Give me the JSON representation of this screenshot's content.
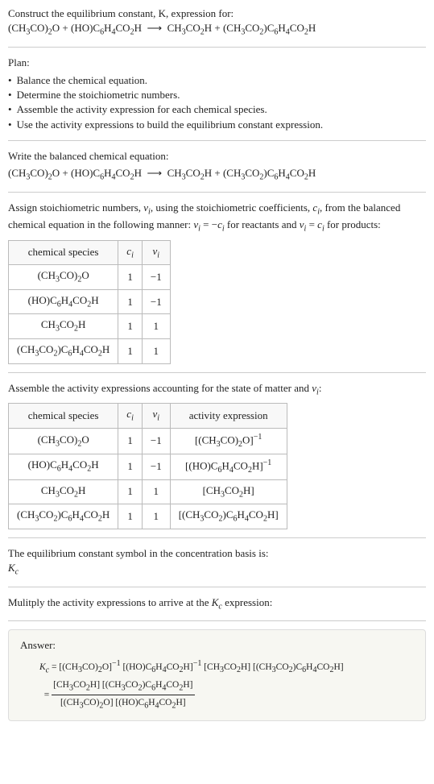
{
  "header": {
    "line1": "Construct the equilibrium constant, K, expression for:",
    "equation": "(CH₃CO)₂O + (HO)C₆H₄CO₂H ⟶ CH₃CO₂H + (CH₃CO₂)C₆H₄CO₂H"
  },
  "plan": {
    "title": "Plan:",
    "items": [
      "Balance the chemical equation.",
      "Determine the stoichiometric numbers.",
      "Assemble the activity expression for each chemical species.",
      "Use the activity expressions to build the equilibrium constant expression."
    ]
  },
  "balanced": {
    "title": "Write the balanced chemical equation:",
    "equation": "(CH₃CO)₂O + (HO)C₆H₄CO₂H ⟶ CH₃CO₂H + (CH₃CO₂)C₆H₄CO₂H"
  },
  "stoich": {
    "intro": "Assign stoichiometric numbers, νᵢ, using the stoichiometric coefficients, cᵢ, from the balanced chemical equation in the following manner: νᵢ = −cᵢ for reactants and νᵢ = cᵢ for products:",
    "headers": {
      "h1": "chemical species",
      "h2": "cᵢ",
      "h3": "νᵢ"
    },
    "rows": [
      {
        "species": "(CH₃CO)₂O",
        "c": "1",
        "v": "−1"
      },
      {
        "species": "(HO)C₆H₄CO₂H",
        "c": "1",
        "v": "−1"
      },
      {
        "species": "CH₃CO₂H",
        "c": "1",
        "v": "1"
      },
      {
        "species": "(CH₃CO₂)C₆H₄CO₂H",
        "c": "1",
        "v": "1"
      }
    ]
  },
  "activity": {
    "intro": "Assemble the activity expressions accounting for the state of matter and νᵢ:",
    "headers": {
      "h1": "chemical species",
      "h2": "cᵢ",
      "h3": "νᵢ",
      "h4": "activity expression"
    },
    "rows": [
      {
        "species": "(CH₃CO)₂O",
        "c": "1",
        "v": "−1",
        "expr": "[(CH₃CO)₂O]⁻¹"
      },
      {
        "species": "(HO)C₆H₄CO₂H",
        "c": "1",
        "v": "−1",
        "expr": "[(HO)C₆H₄CO₂H]⁻¹"
      },
      {
        "species": "CH₃CO₂H",
        "c": "1",
        "v": "1",
        "expr": "[CH₃CO₂H]"
      },
      {
        "species": "(CH₃CO₂)C₆H₄CO₂H",
        "c": "1",
        "v": "1",
        "expr": "[(CH₃CO₂)C₆H₄CO₂H]"
      }
    ]
  },
  "symbol": {
    "line1": "The equilibrium constant symbol in the concentration basis is:",
    "kc": "K_c"
  },
  "multiply": {
    "line": "Mulitply the activity expressions to arrive at the K_c expression:"
  },
  "answer": {
    "title": "Answer:",
    "line1": "K_c = [(CH₃CO)₂O]⁻¹ [(HO)C₆H₄CO₂H]⁻¹ [CH₃CO₂H] [(CH₃CO₂)C₆H₄CO₂H]",
    "frac_num": "[CH₃CO₂H] [(CH₃CO₂)C₆H₄CO₂H]",
    "frac_den": "[(CH₃CO)₂O] [(HO)C₆H₄CO₂H]"
  }
}
